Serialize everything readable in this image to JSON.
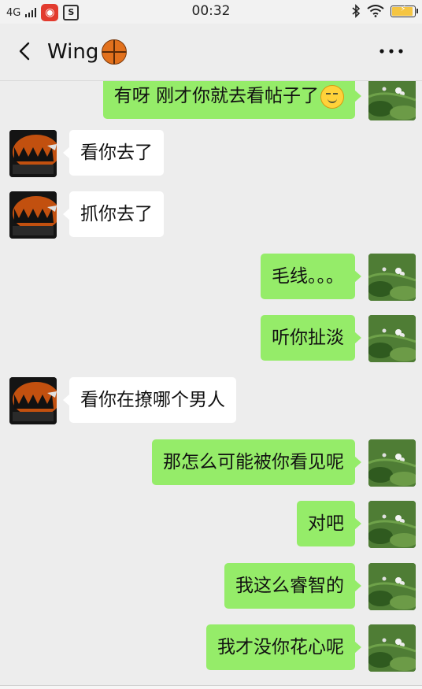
{
  "status_bar": {
    "network": "4G",
    "time": "00:32",
    "app_icons": [
      "netease-music-icon",
      "s-app-icon"
    ],
    "battery_state": "charging"
  },
  "header": {
    "title": "Wing",
    "title_icon": "basketball-icon",
    "back_icon": "chevron-left-icon",
    "more_icon": "more-dots-icon"
  },
  "colors": {
    "my_bubble": "#95ec69",
    "friend_bubble": "#ffffff",
    "chat_background": "#ededed"
  },
  "messages": [
    {
      "sender": "me",
      "text": "有呀  刚才你就去看帖子了",
      "emoji": "smirk-emoji"
    },
    {
      "sender": "friend",
      "text": "看你去了"
    },
    {
      "sender": "friend",
      "text": "抓你去了"
    },
    {
      "sender": "me",
      "text": "毛线。。。"
    },
    {
      "sender": "me",
      "text": "听你扯淡"
    },
    {
      "sender": "friend",
      "text": "看你在撩哪个男人"
    },
    {
      "sender": "me",
      "text": "那怎么可能被你看见呢"
    },
    {
      "sender": "me",
      "text": "对吧"
    },
    {
      "sender": "me",
      "text": "我这么睿智的"
    },
    {
      "sender": "me",
      "text": "我才没你花心呢"
    }
  ]
}
